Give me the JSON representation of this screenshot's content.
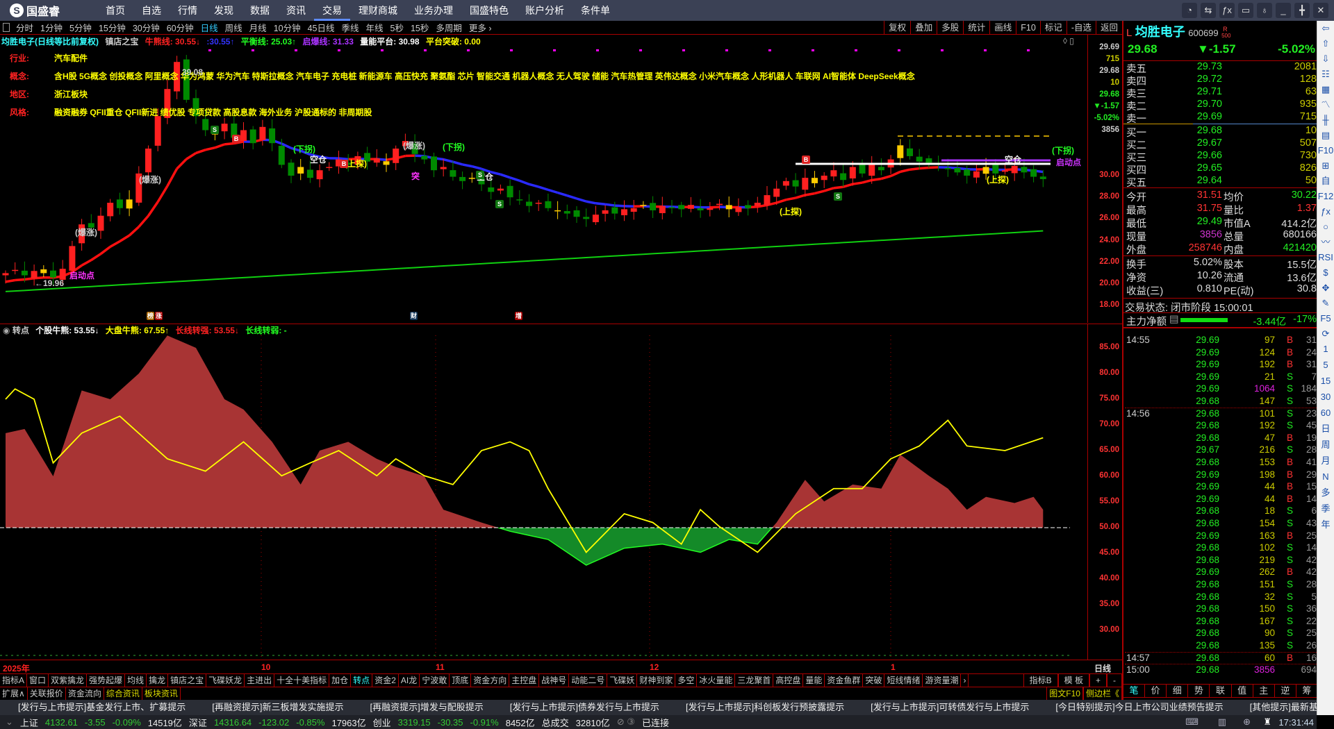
{
  "app": {
    "logo_text": "国盛睿",
    "menu": [
      "首页",
      "自选",
      "行情",
      "发现",
      "数据",
      "资讯",
      "交易",
      "理财商城",
      "业务办理",
      "国盛特色",
      "账户分析",
      "条件单"
    ],
    "active_menu": 6,
    "window_controls": [
      "chat-icon",
      "switch-icon",
      "formula-icon",
      "monitor-icon",
      "shirt-icon",
      "minimize-icon",
      "restore-icon",
      "close-icon"
    ]
  },
  "periods": {
    "items": [
      "分时",
      "1分钟",
      "5分钟",
      "15分钟",
      "30分钟",
      "60分钟",
      "日线",
      "周线",
      "月线",
      "10分钟",
      "45日线",
      "季线",
      "年线",
      "5秒",
      "15秒",
      "多周期",
      "更多 ›"
    ],
    "active": 6
  },
  "tools": [
    "复权",
    "叠加",
    "多股",
    "统计",
    "画线",
    "F10",
    "标记",
    "-自选",
    "返回"
  ],
  "chart_title": {
    "stock": "均胜电子(日线等比前复权)",
    "indicator": "镇店之宝",
    "bull_bear": "牛熊线: 30.55↓",
    "bull_bear2": ":30.55↑",
    "balance": "平衡线: 25.03↑",
    "ignite": "启爆线: 31.33",
    "vol_platform": "量能平台: 30.98",
    "breakout": "平台突破: 0.00"
  },
  "info": {
    "industry_label": "行业:",
    "industry": "汽车配件",
    "concept_label": "概念:",
    "concept": "含H股 5G概念 创投概念 阿里概念 华为鸿蒙 华为汽车 特斯拉概念 汽车电子 充电桩 新能源车 高压快充 聚氨酯 芯片 智能交通 机器人概念 无人驾驶 储能 汽车热管理 英伟达概念 小米汽车概念 人形机器人 车联网 AI智能体 DeepSeek概念",
    "region_label": "地区:",
    "region": "浙江板块",
    "style_label": "风格:",
    "style": "融资融券 QFII重仓 QFII新进 绩优股 专项贷款 高股息款 海外业务 沪股通标的 非周期股"
  },
  "annotations": {
    "down_turn": "(下拐)",
    "up_probe": "(上探)",
    "empty": "空仓",
    "start_point": "启动点",
    "low": "←19.96",
    "high": "39.08",
    "surge": "(爆涨)",
    "bang": "榜",
    "zhang": "涨",
    "cai": "财",
    "zeng": "增",
    "buy": "B",
    "sell": "S",
    "tu": "突"
  },
  "price_axis": {
    "quote": [
      "29.69",
      "715",
      "29.68",
      "10",
      "29.68",
      "▼-1.57",
      "-5.02%",
      "3856"
    ],
    "ticks": [
      "30.00",
      "28.00",
      "26.00",
      "24.00",
      "22.00",
      "20.00",
      "18.00"
    ]
  },
  "chart_data": [
    {
      "type": "candlestick",
      "name": "均胜电子 日线",
      "ylim": [
        17,
        41
      ],
      "close": [
        21.0,
        21.3,
        20.8,
        21.2,
        21.0,
        20.6,
        21.4,
        23.5,
        25.5,
        25.2,
        26.3,
        27.5,
        27.0,
        27.8,
        30.2,
        32.5,
        35.5,
        38.0,
        40.5,
        37.0,
        35.5,
        34.2,
        33.8,
        34.8,
        33.5,
        34.2,
        33.0,
        34.5,
        33.0,
        31.0,
        30.0,
        30.8,
        29.8,
        30.5,
        30.8,
        31.5,
        31.0,
        31.8,
        31.3,
        31.6,
        31.0,
        32.5,
        33.2,
        32.0,
        31.5,
        30.5,
        30.8,
        29.9,
        29.5,
        29.8,
        29.2,
        28.5,
        28.8,
        28.0,
        27.8,
        27.2,
        27.5,
        27.0,
        26.8,
        26.5,
        26.2,
        26.0,
        26.4,
        26.8,
        26.5,
        26.9,
        27.0,
        27.3,
        26.8,
        27.2,
        27.0,
        26.9,
        27.3,
        26.8,
        27.0,
        27.4,
        26.9,
        27.1,
        27.0,
        27.5,
        28.2,
        28.8,
        29.5,
        29.0,
        29.8,
        29.3,
        30.0,
        30.5,
        29.6,
        30.8,
        30.2,
        31.0,
        30.5,
        31.5,
        32.8,
        31.8,
        31.3,
        31.2,
        31.0,
        30.6,
        30.3,
        30.0,
        30.4,
        30.8,
        30.2,
        30.5,
        30.9,
        30.3,
        29.9,
        29.68
      ],
      "long_ma": [
        19.3,
        24.9
      ],
      "colors": {
        "up": "#ff2020",
        "down": "#008a00",
        "ma_up": "#ff1010",
        "ma_down": "#2a2aff",
        "long_ma": "#10d010"
      }
    },
    {
      "type": "area",
      "name": "转点",
      "ylim": [
        25,
        90
      ],
      "baseline": 50,
      "area": [
        [
          0,
          68.4
        ],
        [
          2,
          69.2
        ],
        [
          5,
          60
        ],
        [
          8,
          76.7
        ],
        [
          11,
          75
        ],
        [
          14,
          80
        ],
        [
          17,
          87.4
        ],
        [
          20,
          85
        ],
        [
          23,
          75
        ],
        [
          25,
          73
        ],
        [
          28,
          66.7
        ],
        [
          31,
          58.4
        ],
        [
          33,
          65
        ],
        [
          36,
          66.7
        ],
        [
          39,
          63.4
        ],
        [
          41,
          61.8
        ],
        [
          44,
          60
        ],
        [
          46,
          53.5
        ],
        [
          50,
          51
        ],
        [
          53,
          49.3
        ],
        [
          57,
          47.7
        ],
        [
          61,
          42.7
        ],
        [
          65,
          46
        ],
        [
          69,
          46.8
        ],
        [
          73,
          45.2
        ],
        [
          76,
          47.7
        ],
        [
          79,
          46.8
        ],
        [
          81,
          51
        ],
        [
          84,
          59.3
        ],
        [
          86,
          55.1
        ],
        [
          89,
          58.4
        ],
        [
          92,
          57.6
        ],
        [
          94,
          64.2
        ],
        [
          97,
          60.1
        ],
        [
          99,
          57.6
        ],
        [
          101,
          53.5
        ],
        [
          103,
          56
        ],
        [
          106,
          54.8
        ],
        [
          108,
          56
        ],
        [
          109,
          53.5
        ]
      ],
      "line": [
        [
          0,
          75
        ],
        [
          1,
          77
        ],
        [
          3,
          75
        ],
        [
          5,
          62.6
        ],
        [
          8,
          68.4
        ],
        [
          12,
          71.7
        ],
        [
          15,
          66.7
        ],
        [
          17,
          63.4
        ],
        [
          21,
          61
        ],
        [
          25,
          66.7
        ],
        [
          29,
          60.1
        ],
        [
          32,
          62.6
        ],
        [
          35,
          65
        ],
        [
          39,
          60.1
        ],
        [
          41,
          63.4
        ],
        [
          44,
          60.1
        ],
        [
          47,
          58.4
        ],
        [
          50,
          65
        ],
        [
          53,
          66.7
        ],
        [
          55,
          65
        ],
        [
          57,
          57.6
        ],
        [
          61,
          45.2
        ],
        [
          65,
          52.7
        ],
        [
          68,
          51
        ],
        [
          71,
          46.8
        ],
        [
          73,
          53.5
        ],
        [
          75,
          50.2
        ],
        [
          79,
          45.2
        ],
        [
          83,
          52.7
        ],
        [
          87,
          57.6
        ],
        [
          90,
          57.6
        ],
        [
          93,
          63.4
        ],
        [
          96,
          65.9
        ],
        [
          99,
          70.9
        ],
        [
          101,
          65.9
        ],
        [
          105,
          65
        ],
        [
          109,
          67.5
        ]
      ],
      "colors": {
        "above": "#a83434",
        "below": "#148a28",
        "line": "#ffff00"
      },
      "ticks": [
        "85.00",
        "80.00",
        "75.00",
        "70.00",
        "65.00",
        "60.00",
        "55.00",
        "50.00",
        "45.00",
        "40.00",
        "35.00",
        "30.00"
      ]
    }
  ],
  "indicator_header": {
    "name": "转点",
    "stock_bull": "个股牛熊: 53.55↓",
    "market_bull": "大盘牛熊: 67.55↑",
    "long_strong": "长线转强: 53.55↓",
    "long_weak": "长线转弱: -"
  },
  "date_axis": {
    "labels": [
      "2025年",
      "10",
      "11",
      "12",
      "1"
    ],
    "period": "日线"
  },
  "tabs_row1": [
    "指标A",
    "窗口",
    "双紫擒龙",
    "强势起爆",
    "均线",
    "擒龙",
    "镇店之宝",
    "飞碟妖龙",
    "主进出",
    "十全十美指标",
    "加仓",
    "转点",
    "资金2",
    "AI龙",
    "宁波敢",
    "顶底",
    "资金方向",
    "主控盘",
    "战神号",
    "动能二号",
    "飞碟妖",
    "财神到家",
    "多空",
    "冰火量能",
    "三龙聚首",
    "高控盘",
    "量能",
    "资金鱼群",
    "突破",
    "短线情绪",
    "游资量潮",
    "›"
  ],
  "tabs_row1_active": 11,
  "tabs_row1_right": [
    "指标B",
    "模 板",
    "+",
    "-"
  ],
  "tabs_row2": [
    "扩展∧",
    "关联报价",
    "资金流向",
    "综合资讯",
    "板块资讯"
  ],
  "tabs_row2_right": [
    "图文F10",
    "侧边栏《"
  ],
  "news": [
    "[发行与上市提示]基金发行上市、扩募提示",
    "[再融资提示]新三板增发实施提示",
    "[再融资提示]增发与配股提示",
    "[发行与上市提示]债券发行与上市提示",
    "[发行与上市提示]科创板发行预披露提示",
    "[发行与上市提示]可转债发行与上市提示",
    "[今日特别提示]今日上市公司业绩预告提示",
    "[其他提示]最新基金分红提示"
  ],
  "status": {
    "sh": "上证",
    "sh_val": "4132.61",
    "sh_chg": "-3.55",
    "sh_pct": "-0.09%",
    "sh_amt": "14519亿",
    "sz": "深证",
    "sz_val": "14316.64",
    "sz_chg": "-123.02",
    "sz_pct": "-0.85%",
    "sz_amt": "17963亿",
    "cy": "创业",
    "cy_val": "3319.15",
    "cy_chg": "-30.35",
    "cy_pct": "-0.91%",
    "cy_amt": "8452亿",
    "total_label": "总成交",
    "total": "32810亿",
    "conn": "已连接",
    "time": "17:31:44"
  },
  "quote": {
    "flag": "L",
    "name": "均胜电子",
    "code": "600699",
    "r_badge": "R",
    "r_sub": "500",
    "price": "29.68",
    "change": "▼-1.57",
    "pct": "-5.02%",
    "asks": [
      [
        "卖五",
        "29.73",
        "2081"
      ],
      [
        "卖四",
        "29.72",
        "128"
      ],
      [
        "卖三",
        "29.71",
        "63"
      ],
      [
        "卖二",
        "29.70",
        "935"
      ],
      [
        "卖一",
        "29.69",
        "715"
      ]
    ],
    "bids": [
      [
        "买一",
        "29.68",
        "10"
      ],
      [
        "买二",
        "29.67",
        "507"
      ],
      [
        "买三",
        "29.66",
        "730"
      ],
      [
        "买四",
        "29.65",
        "826"
      ],
      [
        "买五",
        "29.64",
        "50"
      ]
    ],
    "stats": [
      [
        "今开",
        "31.51",
        "均价",
        "30.22"
      ],
      [
        "最高",
        "31.75",
        "量比",
        "1.37"
      ],
      [
        "最低",
        "29.49",
        "市值A",
        "414.2亿"
      ],
      [
        "现量",
        "3856",
        "总量",
        "680166"
      ],
      [
        "外盘",
        "258746",
        "内盘",
        "421420"
      ]
    ],
    "fund": [
      [
        "换手",
        "5.02%",
        "股本",
        "15.5亿"
      ],
      [
        "净资",
        "10.26",
        "流通",
        "13.6亿"
      ],
      [
        "收益(三)",
        "0.810",
        "PE(动)",
        "30.8"
      ]
    ],
    "state": "交易状态: 闭市阶段 15:00:01",
    "main_label": "主力净额",
    "main_val": "-3.44亿",
    "main_pct": "-17%",
    "main_ratio": 0.17
  },
  "ticks": [
    [
      "14:55",
      "29.69",
      "97",
      "B",
      "31"
    ],
    [
      "",
      "29.69",
      "124",
      "B",
      "24"
    ],
    [
      "",
      "29.69",
      "192",
      "B",
      "31"
    ],
    [
      "",
      "29.69",
      "21",
      "S",
      "7"
    ],
    [
      "",
      "29.69",
      "1064",
      "S",
      "184"
    ],
    [
      "",
      "29.68",
      "147",
      "S",
      "53"
    ],
    [
      "14:56",
      "29.68",
      "101",
      "S",
      "23"
    ],
    [
      "",
      "29.68",
      "192",
      "S",
      "45"
    ],
    [
      "",
      "29.68",
      "47",
      "B",
      "19"
    ],
    [
      "",
      "29.67",
      "216",
      "S",
      "28"
    ],
    [
      "",
      "29.68",
      "153",
      "B",
      "41"
    ],
    [
      "",
      "29.69",
      "198",
      "B",
      "29"
    ],
    [
      "",
      "29.69",
      "44",
      "B",
      "15"
    ],
    [
      "",
      "29.69",
      "44",
      "B",
      "14"
    ],
    [
      "",
      "29.68",
      "18",
      "S",
      "6"
    ],
    [
      "",
      "29.68",
      "154",
      "S",
      "43"
    ],
    [
      "",
      "29.69",
      "163",
      "B",
      "25"
    ],
    [
      "",
      "29.68",
      "102",
      "S",
      "14"
    ],
    [
      "",
      "29.68",
      "219",
      "S",
      "42"
    ],
    [
      "",
      "29.69",
      "262",
      "B",
      "42"
    ],
    [
      "",
      "29.68",
      "151",
      "S",
      "28"
    ],
    [
      "",
      "29.68",
      "32",
      "S",
      "5"
    ],
    [
      "",
      "29.68",
      "150",
      "S",
      "36"
    ],
    [
      "",
      "29.68",
      "167",
      "S",
      "22"
    ],
    [
      "",
      "29.68",
      "90",
      "S",
      "25"
    ],
    [
      "",
      "29.68",
      "135",
      "S",
      "26"
    ],
    [
      "14:57",
      "29.68",
      "60",
      "B",
      "16"
    ],
    [
      "15:00",
      "29.68",
      "3856",
      "",
      "694"
    ]
  ],
  "rp_tabs": [
    "笔",
    "价",
    "细",
    "势",
    "联",
    "值",
    "主",
    "逆",
    "筹"
  ],
  "side": [
    "⇦",
    "⇧",
    "⇩",
    "☷",
    "▦",
    "〽",
    "╫",
    "▤",
    "F10",
    "⊞",
    "自",
    "F12",
    "ƒx",
    "○",
    "〰",
    "RSI",
    "$",
    "✥",
    "✎",
    "F5",
    "⟳",
    "1",
    "5",
    "15",
    "30",
    "60",
    "日",
    "周",
    "月",
    "N",
    "多",
    "季",
    "年"
  ]
}
